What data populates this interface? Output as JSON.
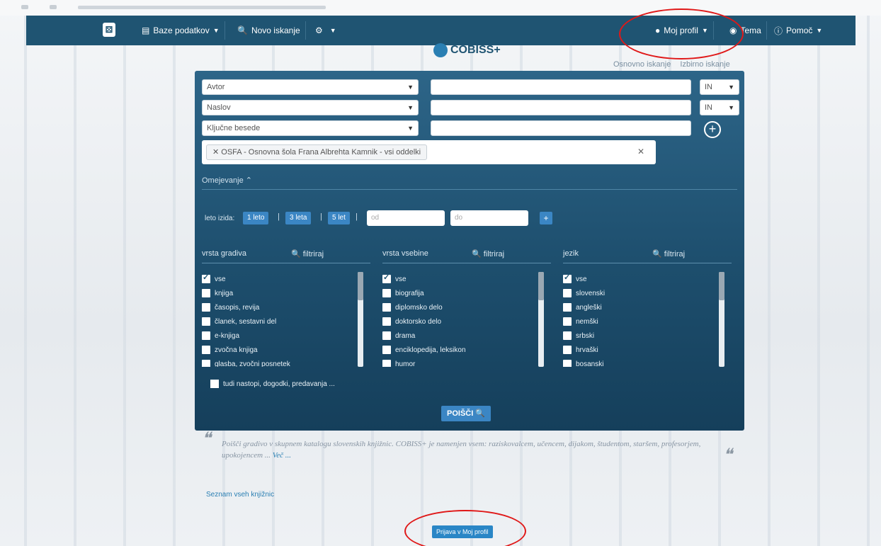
{
  "navbar": {
    "logo_glyph": "⚄",
    "databases": "Baze podatkov",
    "new_search": "Novo iskanje",
    "settings_icon": "⚙",
    "my_profile": "Moj profil",
    "theme": "Tema",
    "help": "Pomoč"
  },
  "brand": {
    "name": "COBISS+"
  },
  "search_links": {
    "basic": "Osnovno iskanje",
    "expert": "Izbirno iskanje"
  },
  "search": {
    "rows": [
      {
        "field": "Avtor",
        "operator": "IN"
      },
      {
        "field": "Naslov",
        "operator": "IN"
      },
      {
        "field": "Ključne besede",
        "operator": ""
      }
    ],
    "scope_tag": "✕ OSFA - Osnovna šola Frana Albrehta Kamnik - vsi oddelki",
    "scope_clear": "✕"
  },
  "restrict": {
    "label": "Omejevanje",
    "years_label": "leto izida:",
    "year_buttons": [
      "1 leto",
      "3 leta",
      "5 let"
    ],
    "from_placeholder": "od",
    "to_placeholder": "do",
    "plus": "+"
  },
  "filters": [
    {
      "title": "vrsta gradiva",
      "filter_label": "filtriraj",
      "items": [
        {
          "label": "vse",
          "checked": true
        },
        {
          "label": "knjiga",
          "checked": false
        },
        {
          "label": "časopis, revija",
          "checked": false
        },
        {
          "label": "članek, sestavni del",
          "checked": false
        },
        {
          "label": "e-knjiga",
          "checked": false
        },
        {
          "label": "zvočna knjiga",
          "checked": false
        },
        {
          "label": "glasba, zvočni posnetek",
          "checked": false
        }
      ]
    },
    {
      "title": "vrsta vsebine",
      "filter_label": "filtriraj",
      "items": [
        {
          "label": "vse",
          "checked": true
        },
        {
          "label": "biografija",
          "checked": false
        },
        {
          "label": "diplomsko delo",
          "checked": false
        },
        {
          "label": "doktorsko delo",
          "checked": false
        },
        {
          "label": "drama",
          "checked": false
        },
        {
          "label": "enciklopedija, leksikon",
          "checked": false
        },
        {
          "label": "humor",
          "checked": false
        }
      ]
    },
    {
      "title": "jezik",
      "filter_label": "filtriraj",
      "items": [
        {
          "label": "vse",
          "checked": true
        },
        {
          "label": "slovenski",
          "checked": false
        },
        {
          "label": "angleški",
          "checked": false
        },
        {
          "label": "nemški",
          "checked": false
        },
        {
          "label": "srbski",
          "checked": false
        },
        {
          "label": "hrvaški",
          "checked": false
        },
        {
          "label": "bosanski",
          "checked": false
        }
      ]
    }
  ],
  "extra_option": "tudi nastopi, dogodki, predavanja ...",
  "go_button": "POIŠČI",
  "quote": {
    "text": "Poišči gradivo v skupnem katalogu slovenskih knjižnic. COBISS+ je namenjen vsem: raziskovalcem, učencem, dijakom, študentom, staršem, profesorjem, upokojencem ...",
    "more": "Več ..."
  },
  "libraries_link": "Seznam vseh knjižnic",
  "login_button": "Prijava v Moj profil",
  "colors": {
    "navbar": "#1f5472",
    "panel": "#1d4e6d",
    "accent": "#3b86c4",
    "annotation": "#e01818"
  }
}
